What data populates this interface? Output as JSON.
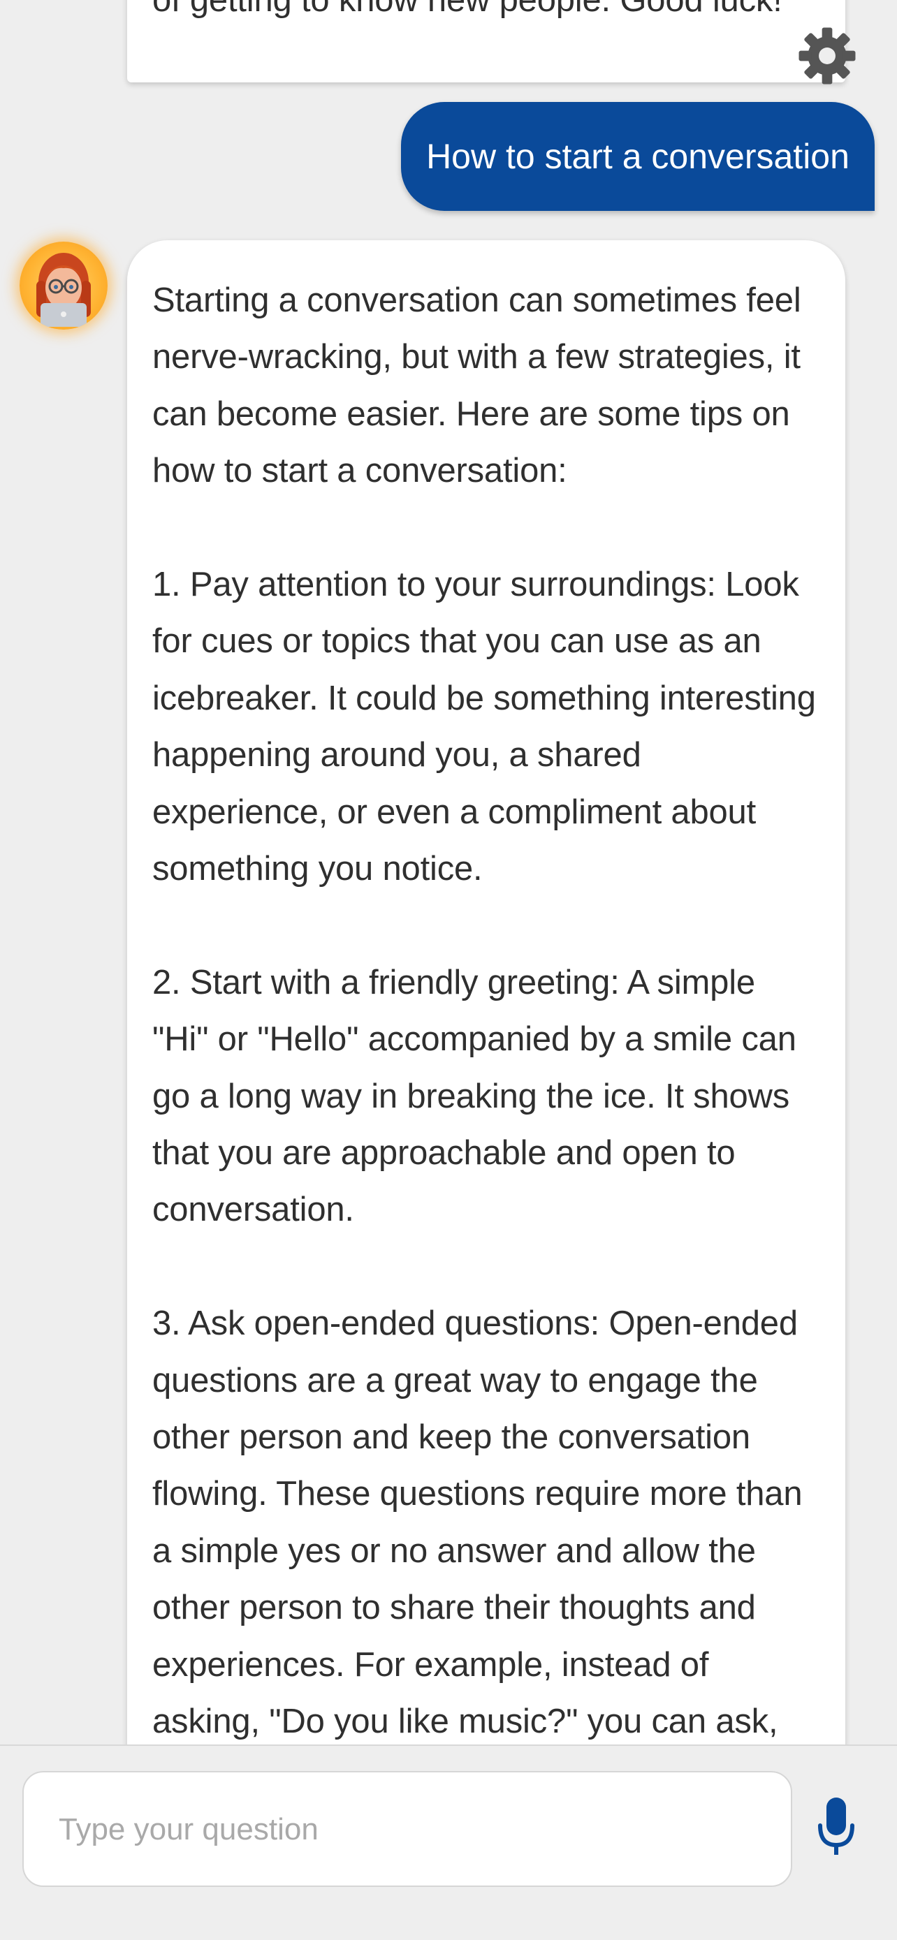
{
  "messages": {
    "previous_bot_tail": "of getting to know new people. Good luck!",
    "user_message": "How to start a conversation",
    "bot_reply": {
      "intro": "Starting a conversation can sometimes feel nerve-wracking, but with a few strategies, it can become easier. Here are some tips on how to start a conversation:",
      "tip1": "1. Pay attention to your surroundings: Look for cues or topics that you can use as an icebreaker. It could be something interesting happening around you, a shared experience, or even a compliment about something you notice.",
      "tip2": "2. Start with a friendly greeting: A simple \"Hi\" or \"Hello\" accompanied by a smile can go a long way in breaking the ice. It shows that you are approachable and open to conversation.",
      "tip3": "3. Ask open-ended questions: Open-ended questions are a great way to engage the other person and keep the conversation flowing. These questions require more than a simple yes or no answer and allow the other person to share their thoughts and experiences. For example, instead of asking, \"Do you like music?\" you can ask,"
    }
  },
  "input": {
    "placeholder": "Type your question",
    "value": ""
  },
  "icons": {
    "settings": "gear-icon",
    "voice": "microphone-icon",
    "assistant_avatar": "avatar-memoji"
  },
  "colors": {
    "user_bubble": "#0a4a9a",
    "background": "#eeeeee",
    "mic": "#0a4a9a",
    "gear": "#555555"
  }
}
